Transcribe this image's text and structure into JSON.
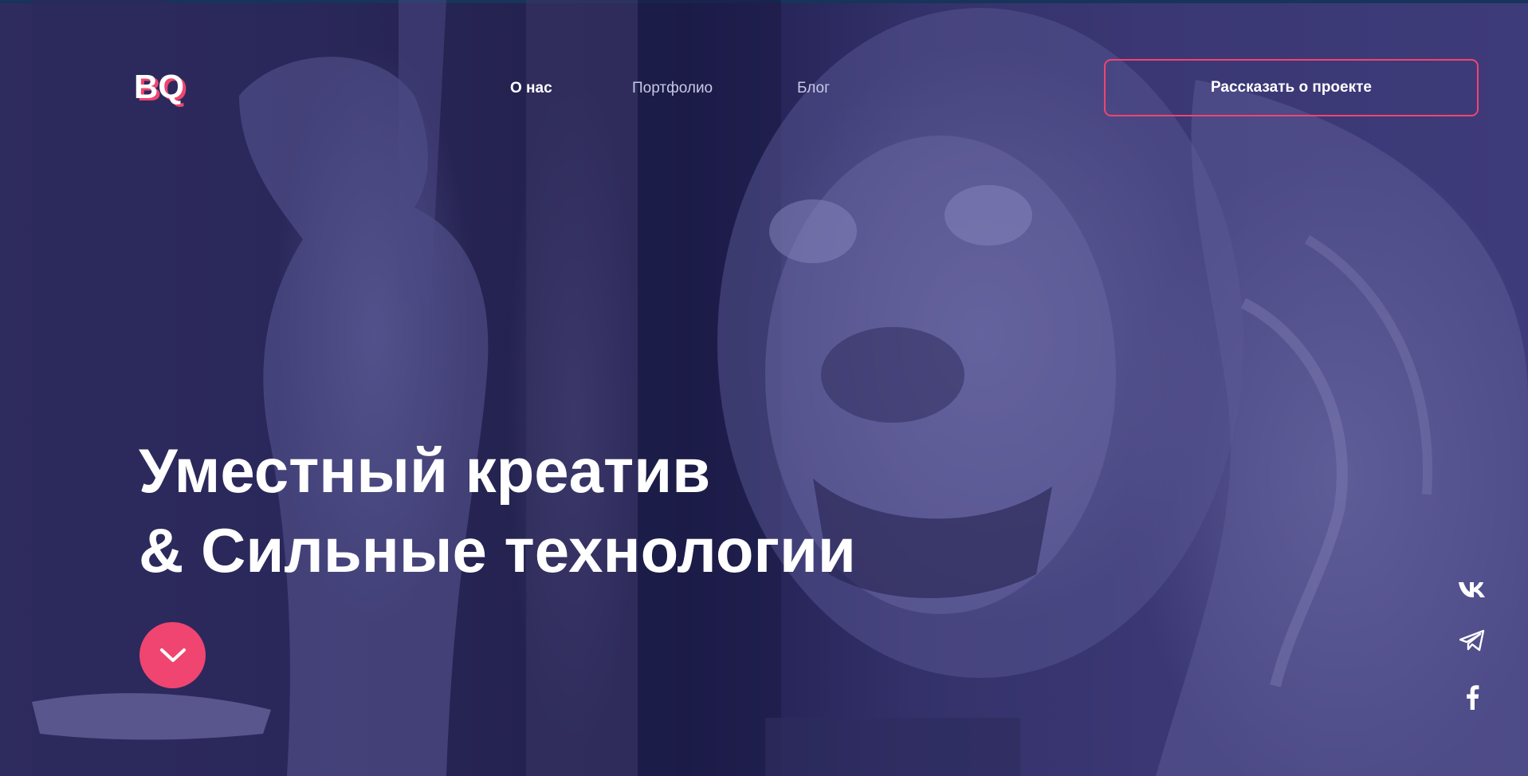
{
  "header": {
    "logo_text": "BQ",
    "nav": {
      "about": "О нас",
      "portfolio": "Портфолио",
      "blog": "Блог"
    },
    "cta_label": "Рассказать о проекте"
  },
  "hero": {
    "headline_line1": "Уместный креатив",
    "headline_line2": "& Сильные технологии",
    "scroll_icon": "chevron-down-icon"
  },
  "social": {
    "icons": [
      "vk-icon",
      "telegram-icon",
      "facebook-icon"
    ]
  },
  "colors": {
    "accent": "#ef4570",
    "overlay": "#1f1d4f",
    "text": "#ffffff",
    "nav_muted": "#c9c8e6"
  }
}
